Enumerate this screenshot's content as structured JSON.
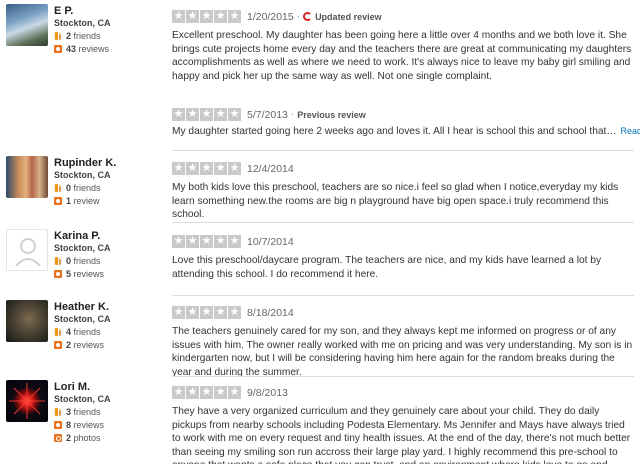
{
  "reviews": [
    {
      "user": {
        "name": "E P.",
        "location": "Stockton, CA",
        "friends": "2",
        "friends_label": "friends",
        "reviews": "43",
        "reviews_label": "reviews"
      },
      "date": "1/20/2015",
      "tag": "Updated review",
      "text": "Excellent preschool. My daughter has been going here a little over 4 months and we both love it. She brings cute projects home every day and the teachers there are great at communicating my daughters accomplishments as well as where we need to work. It's always nice to leave my baby girl smiling and happy and pick her up the same way as well. Not one single complaint."
    },
    {
      "date": "5/7/2013",
      "tag": "Previous review",
      "text": "My daughter started going here 2 weeks ago and loves it. All I hear is school this and school that…",
      "read_more": "Read more"
    },
    {
      "user": {
        "name": "Rupinder K.",
        "location": "Stockton, CA",
        "friends": "0",
        "friends_label": "friends",
        "reviews": "1",
        "reviews_label": "review"
      },
      "date": "12/4/2014",
      "text": "My both kids love this preschool, teachers are so nice.i feel so glad when I notice,everyday my kids learn something new.the rooms are big n playground have big open space.i truly recommend this school."
    },
    {
      "user": {
        "name": "Karina P.",
        "location": "Stockton, CA",
        "friends": "0",
        "friends_label": "friends",
        "reviews": "5",
        "reviews_label": "reviews"
      },
      "date": "10/7/2014",
      "text": "Love this preschool/daycare program. The teachers are nice, and my kids have learned a lot by attending this school. I do recommend it here."
    },
    {
      "user": {
        "name": "Heather K.",
        "location": "Stockton, CA",
        "friends": "4",
        "friends_label": "friends",
        "reviews": "2",
        "reviews_label": "reviews"
      },
      "date": "8/18/2014",
      "text": "The teachers genuinely cared for my son, and they always kept me informed on progress or of any issues with him.  The owner really worked with me on pricing and was very understanding.  My son is in kindergarten now, but I will be considering having him here again for the random breaks during the year and during the summer."
    },
    {
      "user": {
        "name": "Lori M.",
        "location": "Stockton, CA",
        "friends": "3",
        "friends_label": "friends",
        "reviews": "8",
        "reviews_label": "reviews",
        "photos": "2",
        "photos_label": "photos"
      },
      "date": "9/8/2013",
      "text": "They have a very organized curriculum and they genuinely care about your child. They do daily pickups from nearby schools including Podesta Elementary. Ms Jennifer and Mays have always tried to work with me on every request and tiny health issues. At the end of the day, there's not much better than seeing my smiling son run accross their large play yard. I highly recommend this pre-school to anyone that wants a safe place that you can trust, and an environment where kids love to go and learn!"
    }
  ],
  "rating_stars": 5,
  "colors": {
    "star_bg": "#c9c9c9",
    "link": "#0073bb",
    "update_icon": "#d32323",
    "accent": "#e8731e"
  }
}
